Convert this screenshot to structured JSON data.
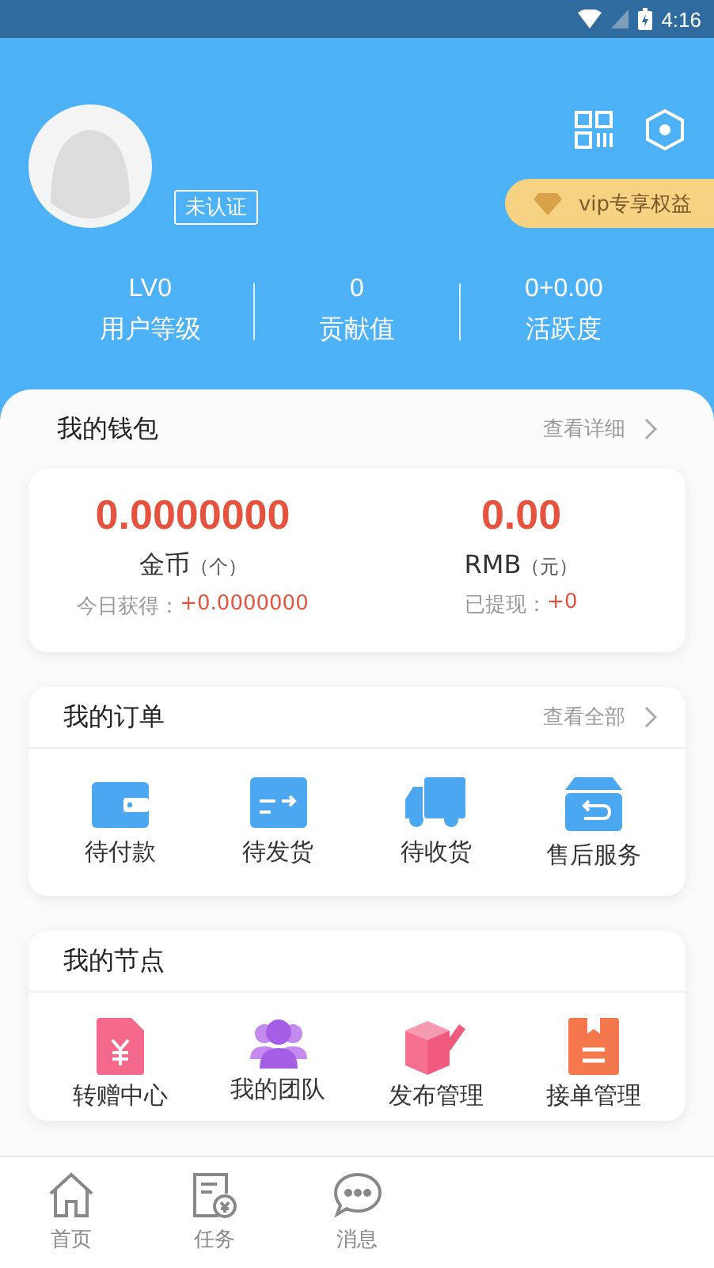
{
  "status_bar": {
    "time": "4:16"
  },
  "profile": {
    "badge": "未认证",
    "vip": "vip专享权益"
  },
  "stats": [
    {
      "value": "LV0",
      "label": "用户等级"
    },
    {
      "value": "0",
      "label": "贡献值"
    },
    {
      "value": "0+0.00",
      "label": "活跃度"
    }
  ],
  "wallet": {
    "title": "我的钱包",
    "link": "查看详细",
    "columns": [
      {
        "amount": "0.0000000",
        "unit": "金币",
        "unit_note": "（个）",
        "sub_label": "今日获得：",
        "sub_value": "+0.0000000"
      },
      {
        "amount": "0.00",
        "unit": "RMB",
        "unit_note": "（元）",
        "sub_label": "已提现：",
        "sub_value": "+0"
      }
    ]
  },
  "orders": {
    "title": "我的订单",
    "link": "查看全部",
    "items": [
      "待付款",
      "待发货",
      "待收货",
      "售后服务"
    ]
  },
  "nodes": {
    "title": "我的节点",
    "items": [
      "转赠中心",
      "我的团队",
      "发布管理",
      "接单管理"
    ]
  },
  "tab_bar": [
    {
      "label": "首页",
      "selected": false
    },
    {
      "label": "任务",
      "selected": false
    },
    {
      "label": "消息",
      "selected": false
    }
  ]
}
